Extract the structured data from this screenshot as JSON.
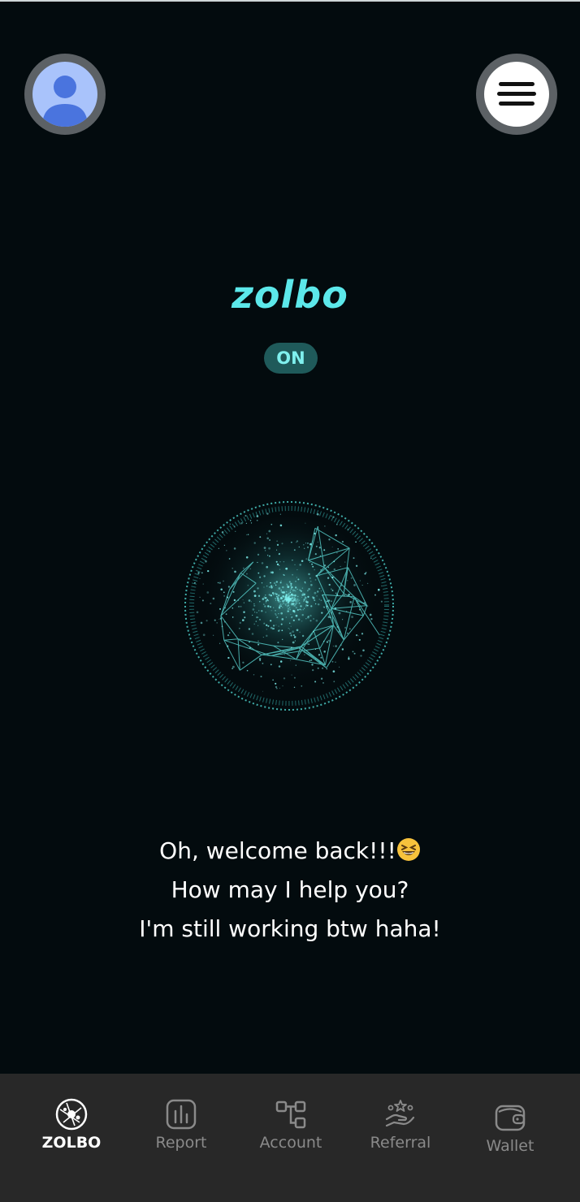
{
  "app": {
    "logo_text": "zolbo",
    "status_label": "ON"
  },
  "header": {
    "avatar_icon": "user-avatar-icon",
    "menu_icon": "hamburger-menu-icon"
  },
  "greeting": {
    "line1": "Oh, welcome back!!!",
    "line1_emoji": "grinning-squinting-face-emoji",
    "line2": "How may I help you?",
    "line3": "I'm still working btw haha!"
  },
  "bottom_nav": {
    "items": [
      {
        "label": "ZOLBO",
        "icon": "zolbo-sphere-icon",
        "active": true
      },
      {
        "label": "Report",
        "icon": "bar-chart-icon",
        "active": false
      },
      {
        "label": "Account",
        "icon": "account-flow-icon",
        "active": false
      },
      {
        "label": "Referral",
        "icon": "hand-stars-icon",
        "active": false
      },
      {
        "label": "Wallet",
        "icon": "wallet-icon",
        "active": false
      }
    ]
  },
  "colors": {
    "background": "#030b0e",
    "accent": "#5ce8ea",
    "nav_background": "#282828"
  }
}
